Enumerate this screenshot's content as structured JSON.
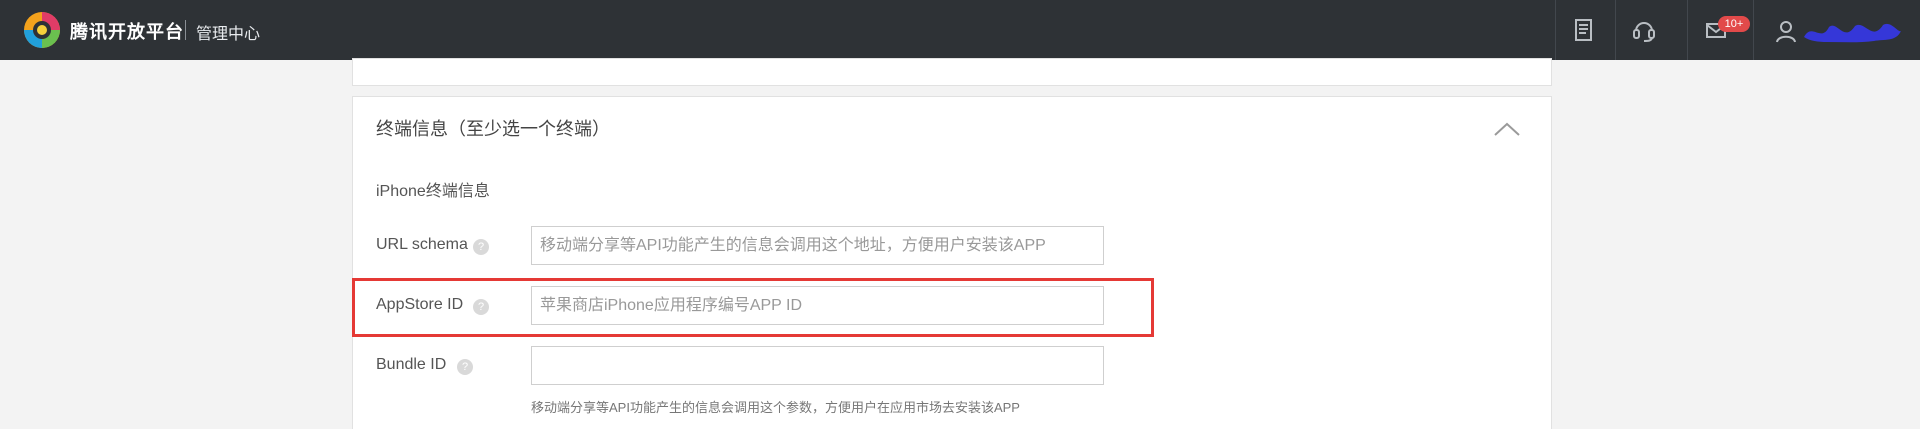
{
  "header": {
    "brand": "腾讯开放平台",
    "subtitle": "管理中心",
    "messages_badge": "10+"
  },
  "section": {
    "title": "终端信息（至少选一个终端）",
    "subheading": "iPhone终端信息"
  },
  "fields": [
    {
      "label": "URL schema",
      "placeholder": "移动端分享等API功能产生的信息会调用这个地址，方便用户安装该APP"
    },
    {
      "label": "AppStore ID",
      "placeholder": "苹果商店iPhone应用程序编号APP ID"
    },
    {
      "label": "Bundle ID",
      "placeholder": ""
    }
  ],
  "hint": "移动端分享等API功能产生的信息会调用这个参数，方便用户在应用市场去安装该APP",
  "icons": [
    "brand-logo-icon",
    "document-icon",
    "support-headset-icon",
    "mail-icon",
    "user-icon",
    "collapse-arrow-icon",
    "help-icon"
  ],
  "colors": {
    "topbar": "#2e3236",
    "highlight": "#e53935",
    "badge": "#e24a4a"
  }
}
